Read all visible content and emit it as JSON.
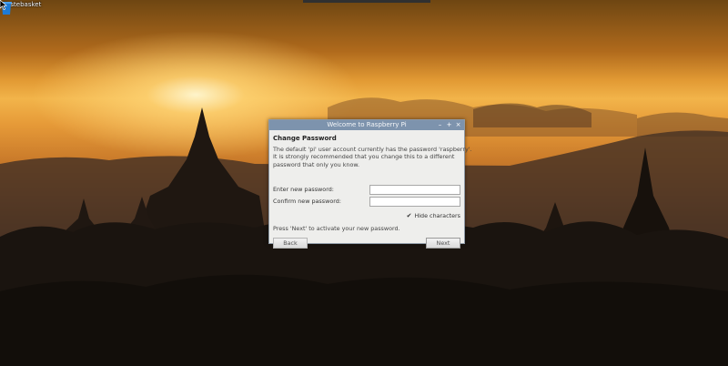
{
  "desktop": {
    "trash_label": "Wastebasket",
    "trash_icon": "trash-icon",
    "colors": {
      "sky_glow": "#f2b44a",
      "trash_blue": "#1e7bd6"
    }
  },
  "dialog": {
    "title": "Welcome to Raspberry Pi",
    "window_buttons": {
      "minimize": "–",
      "maximize": "+",
      "close": "×"
    },
    "heading": "Change Password",
    "description_lines": [
      "The default 'pi' user account currently has the password 'raspberry'.",
      "It is strongly recommended that you change this to a different",
      "password that only you know."
    ],
    "fields": {
      "new_password_label": "Enter new password:",
      "new_password_value": "",
      "confirm_password_label": "Confirm new password:",
      "confirm_password_value": ""
    },
    "hide_characters": {
      "label": "Hide characters",
      "checked": true
    },
    "note": "Press 'Next' to activate your new password.",
    "buttons": {
      "back": "Back",
      "next": "Next"
    },
    "colors": {
      "titlebar": "#7d93ad",
      "body": "#eeeeec"
    }
  }
}
